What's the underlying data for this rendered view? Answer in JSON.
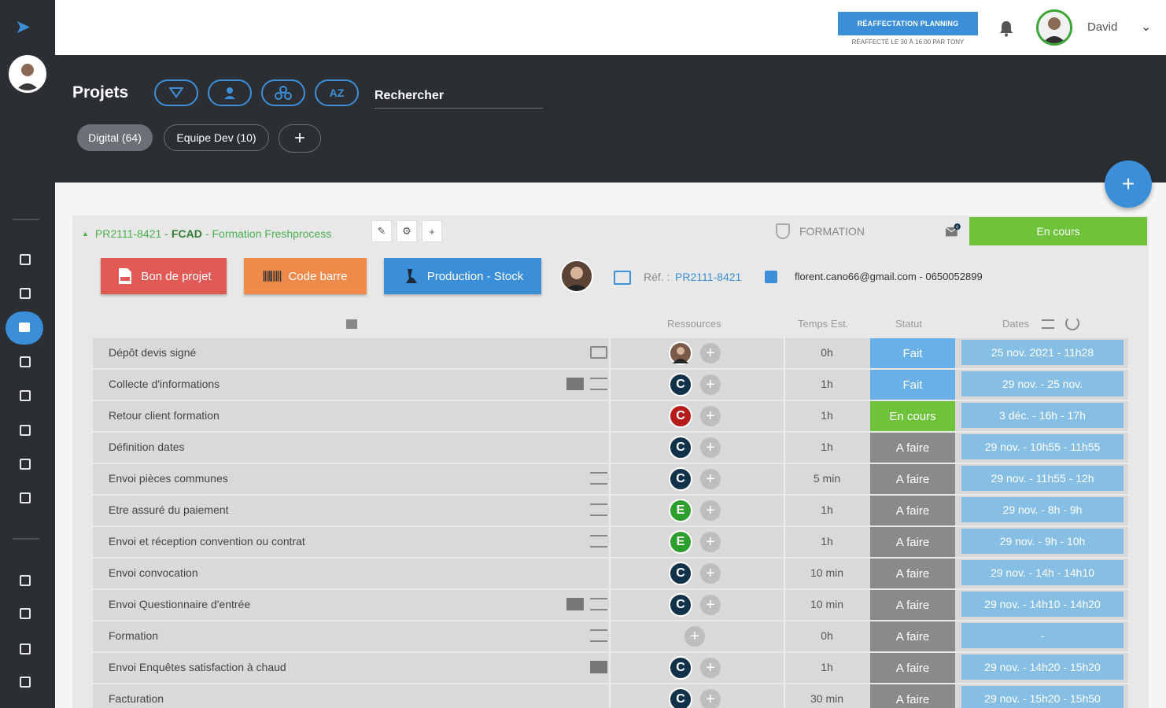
{
  "topbar": {
    "reaffect_button": "RÉAFFECTATION PLANNING",
    "reaffect_sub": "RÉAFFECTÉ LE 30 À 16:00 PAR TONY",
    "user_name": "David"
  },
  "header": {
    "title": "Projets",
    "filter_buttons": [
      {
        "icon": "filter-icon",
        "label": "▼"
      },
      {
        "icon": "user-icon",
        "label": "👤"
      },
      {
        "icon": "group-icon",
        "label": "⚇"
      },
      {
        "icon": "sort-az-icon",
        "label": "AZ"
      }
    ],
    "search_placeholder": "Rechercher",
    "chips": [
      "Digital (64)",
      "Equipe Dev (10)"
    ],
    "add_chip": "+"
  },
  "fab": "+",
  "project": {
    "code": "PR2111-8421",
    "client": "FCAD",
    "name": "Formation Freshprocess",
    "mini_buttons": [
      "✎",
      "⚙",
      "+"
    ],
    "category": "FORMATION",
    "mail_badge_count": "0",
    "status": "En cours",
    "actions": [
      {
        "label": "Bon de projet",
        "icon": "pdf-icon"
      },
      {
        "label": "Code barre",
        "icon": "barcode-icon"
      },
      {
        "label": "Production - Stock",
        "icon": "microscope-icon"
      }
    ],
    "ref_label": "Réf. :",
    "ref_value": "PR2111-8421",
    "contact": "florent.cano66@gmail.com - 0650052899"
  },
  "columns": {
    "ressources": "Ressources",
    "temps": "Temps Est.",
    "statut": "Statut",
    "dates": "Dates"
  },
  "colors": {
    "accent": "#3b8fd8",
    "done": "#68b0e8",
    "in_progress": "#6ec33a",
    "todo": "#8a8a8a",
    "avatar_c_dark": "#12324a",
    "avatar_c_red": "#b71c1c",
    "avatar_e_green": "#2e9e2e"
  },
  "tasks": [
    {
      "name": "Dépôt devis signé",
      "icons": [
        "comment"
      ],
      "resource": "photo",
      "temps": "0h",
      "statut": "Fait",
      "statut_type": "done",
      "dates": "25 nov. 2021 - 11h28"
    },
    {
      "name": "Collecte d'informations",
      "icons": [
        "mail",
        "list"
      ],
      "resource": "C",
      "resource_color": "#12324a",
      "temps": "1h",
      "statut": "Fait",
      "statut_type": "done",
      "dates": "29 nov. - 25 nov."
    },
    {
      "name": "Retour client formation",
      "icons": [],
      "resource": "C",
      "resource_color": "#b71c1c",
      "temps": "1h",
      "statut": "En cours",
      "statut_type": "cours",
      "dates": "3 déc. - 16h - 17h"
    },
    {
      "name": "Définition dates",
      "icons": [],
      "resource": "C",
      "resource_color": "#12324a",
      "temps": "1h",
      "statut": "A faire",
      "statut_type": "todo",
      "dates": "29 nov. - 10h55 - 11h55"
    },
    {
      "name": "Envoi pièces communes",
      "icons": [
        "list"
      ],
      "resource": "C",
      "resource_color": "#12324a",
      "temps": "5 min",
      "statut": "A faire",
      "statut_type": "todo",
      "dates": "29 nov. - 11h55 - 12h"
    },
    {
      "name": "Etre assuré du paiement",
      "icons": [
        "list"
      ],
      "resource": "E",
      "resource_color": "#2e9e2e",
      "temps": "1h",
      "statut": "A faire",
      "statut_type": "todo",
      "dates": "29 nov. - 8h - 9h"
    },
    {
      "name": "Envoi et réception convention ou contrat",
      "icons": [
        "list"
      ],
      "resource": "E",
      "resource_color": "#2e9e2e",
      "temps": "1h",
      "statut": "A faire",
      "statut_type": "todo",
      "dates": "29 nov. - 9h - 10h"
    },
    {
      "name": "Envoi convocation",
      "icons": [],
      "resource": "C",
      "resource_color": "#12324a",
      "temps": "10 min",
      "statut": "A faire",
      "statut_type": "todo",
      "dates": "29 nov. - 14h - 14h10"
    },
    {
      "name": "Envoi Questionnaire d'entrée",
      "icons": [
        "mail",
        "list"
      ],
      "resource": "C",
      "resource_color": "#12324a",
      "temps": "10 min",
      "statut": "A faire",
      "statut_type": "todo",
      "dates": "29 nov. - 14h10 - 14h20"
    },
    {
      "name": "Formation",
      "icons": [
        "list"
      ],
      "resource": "",
      "temps": "0h",
      "statut": "A faire",
      "statut_type": "todo",
      "dates": "-"
    },
    {
      "name": "Envoi Enquêtes satisfaction à chaud",
      "icons": [
        "mail"
      ],
      "resource": "C",
      "resource_color": "#12324a",
      "temps": "1h",
      "statut": "A faire",
      "statut_type": "todo",
      "dates": "29 nov. - 14h20 - 15h20"
    },
    {
      "name": "Facturation",
      "icons": [],
      "resource": "C",
      "resource_color": "#12324a",
      "temps": "30 min",
      "statut": "A faire",
      "statut_type": "todo",
      "dates": "29 nov. - 15h20 - 15h50"
    }
  ]
}
